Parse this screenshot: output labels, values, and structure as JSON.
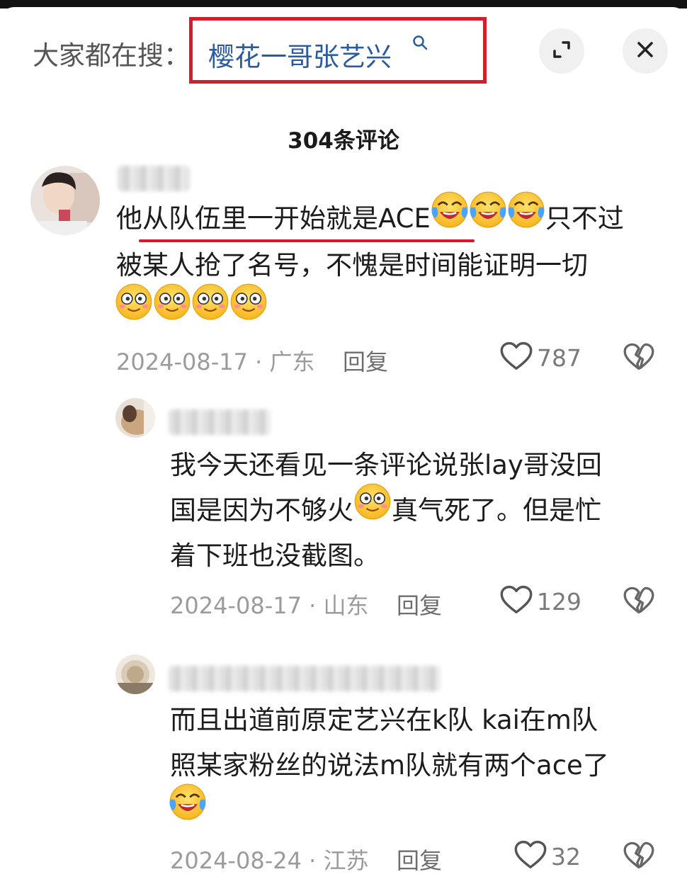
{
  "search": {
    "prefix": "大家都在搜：",
    "term": "樱花一哥张艺兴"
  },
  "header": {
    "comment_count": "304条评论"
  },
  "comments": [
    {
      "lines": [
        "他从队伍里一开始就是ACE",
        "只不过",
        "被某人抢了名号，不愧是时间能证明一切"
      ],
      "emojis": [
        "laugh-cry-emoji",
        "smile-emoji"
      ],
      "date_location": "2024-08-17 · 广东",
      "reply": "回复",
      "likes": "787"
    },
    {
      "lines": [
        "我今天还看见一条评论说张lay哥没回",
        "国是因为不够火",
        "真气死了。但是忙",
        "着下班也没截图。"
      ],
      "date_location": "2024-08-17 · 山东",
      "reply": "回复",
      "likes": "129"
    },
    {
      "lines": [
        "而且出道前原定艺兴在k队 kai在m队",
        "照某家粉丝的说法m队就有两个ace了"
      ],
      "date_location": "2024-08-24 · 江苏",
      "reply": "回复",
      "likes": "32"
    }
  ],
  "colors": {
    "highlight_red": "#d41f2a",
    "search_blue": "#2c5aa0"
  }
}
